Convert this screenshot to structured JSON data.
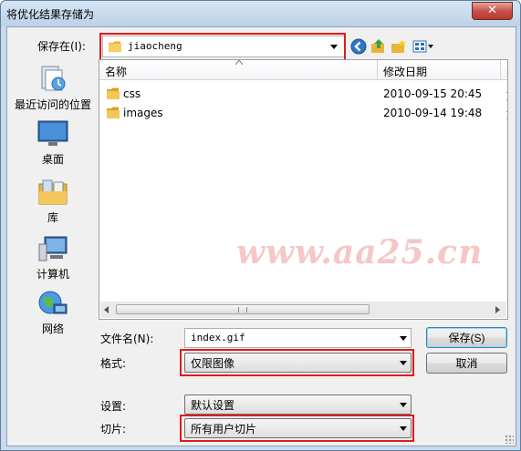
{
  "window": {
    "title": "将优化结果存储为",
    "close_glyph": "✕"
  },
  "location": {
    "label": "保存在(I):",
    "value": "jiaocheng"
  },
  "toolbar": {
    "icons": [
      "back-icon",
      "up-folder-icon",
      "new-folder-icon",
      "view-menu-icon"
    ]
  },
  "places": [
    {
      "label": "最近访问的位置",
      "icon": "recent-places-icon"
    },
    {
      "label": "桌面",
      "icon": "desktop-icon"
    },
    {
      "label": "库",
      "icon": "libraries-icon"
    },
    {
      "label": "计算机",
      "icon": "computer-icon"
    },
    {
      "label": "网络",
      "icon": "network-icon"
    }
  ],
  "file_list": {
    "columns": [
      "名称",
      "修改日期",
      "类"
    ],
    "rows": [
      {
        "name": "css",
        "date": "2010-09-15 20:45",
        "type": "文"
      },
      {
        "name": "images",
        "date": "2010-09-14 19:48",
        "type": "文"
      }
    ]
  },
  "watermark": "www.aa25.cn",
  "filename": {
    "label": "文件名(N):",
    "value": "index.gif"
  },
  "format": {
    "label": "格式:",
    "value": "仅限图像"
  },
  "settings": {
    "label": "设置:",
    "value": "默认设置"
  },
  "slices": {
    "label": "切片:",
    "value": "所有用户切片"
  },
  "buttons": {
    "save": "保存(S)",
    "cancel": "取消"
  },
  "colors": {
    "highlight_box": "#e21b1b",
    "folder": "#e8b43a",
    "watermark": "#f5c7c7"
  }
}
